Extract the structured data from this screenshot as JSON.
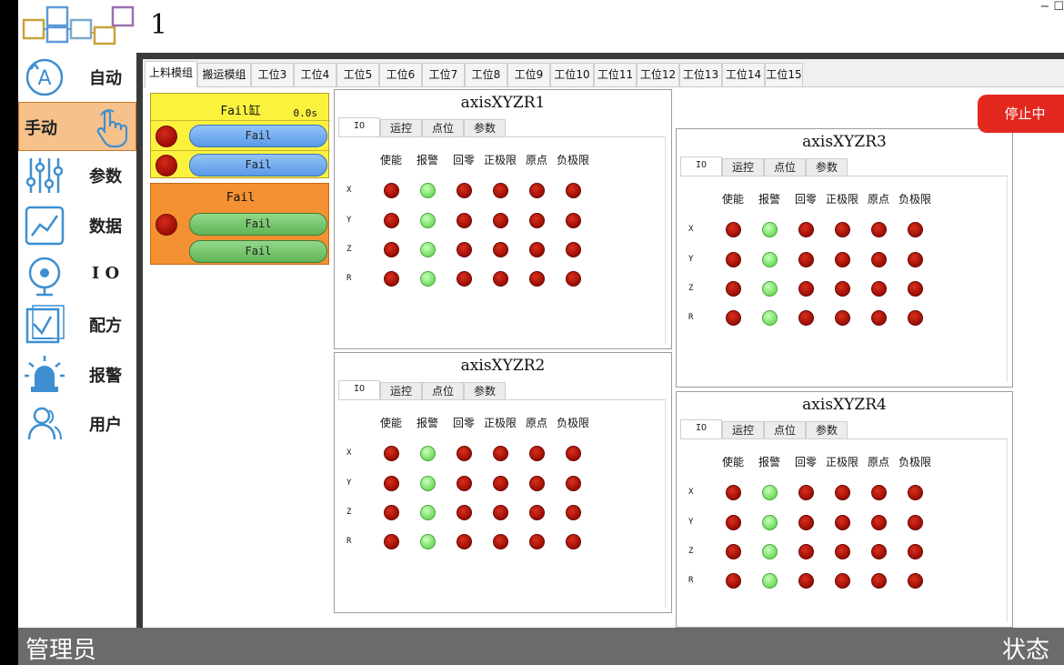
{
  "header": {
    "station_number": "1",
    "window_controls": "− ☐"
  },
  "sidebar": {
    "items": [
      {
        "key": "auto",
        "label": "自动",
        "icon": "auto-mode-icon",
        "active": false
      },
      {
        "key": "manual",
        "label": "手动",
        "icon": "hand-pointer-icon",
        "active": true
      },
      {
        "key": "params",
        "label": "参数",
        "icon": "sliders-icon",
        "active": false
      },
      {
        "key": "data",
        "label": "数据",
        "icon": "chart-icon",
        "active": false
      },
      {
        "key": "io",
        "label": "I O",
        "icon": "io-target-icon",
        "active": false
      },
      {
        "key": "recipe",
        "label": "配方",
        "icon": "recipe-check-icon",
        "active": false
      },
      {
        "key": "alarm",
        "label": "报警",
        "icon": "alarm-light-icon",
        "active": false
      },
      {
        "key": "user",
        "label": "用户",
        "icon": "users-icon",
        "active": false
      }
    ]
  },
  "tabs": [
    "上料模组",
    "搬运模组",
    "工位3",
    "工位4",
    "工位5",
    "工位6",
    "工位7",
    "工位8",
    "工位9",
    "工位10",
    "工位11",
    "工位12",
    "工位13",
    "工位14",
    "工位15"
  ],
  "active_tab": 0,
  "cylinders": [
    {
      "title": "Fail缸",
      "time": "0.0s",
      "color": "#fbf23e",
      "buttons": [
        "Fail",
        "Fail"
      ]
    },
    {
      "title": "Fail",
      "time": "",
      "color": "#f39133",
      "buttons": [
        "Fail",
        "Fail"
      ]
    }
  ],
  "axis_columns": [
    "使能",
    "报警",
    "回零",
    "正极限",
    "原点",
    "负极限"
  ],
  "axis_rows": [
    "X",
    "Y",
    "Z",
    "R"
  ],
  "axis_subtabs": [
    "IO",
    "运控",
    "点位",
    "参数"
  ],
  "axis_panels": [
    {
      "title": "axisXYZR1"
    },
    {
      "title": "axisXYZR2"
    },
    {
      "title": "axisXYZR3"
    },
    {
      "title": "axisXYZR4"
    }
  ],
  "led_states": [
    "red",
    "green",
    "red",
    "red",
    "red",
    "red"
  ],
  "stop_button": {
    "label": "停止中",
    "color": "#e3281f"
  },
  "footer": {
    "user": "管理员",
    "status": "状态"
  }
}
